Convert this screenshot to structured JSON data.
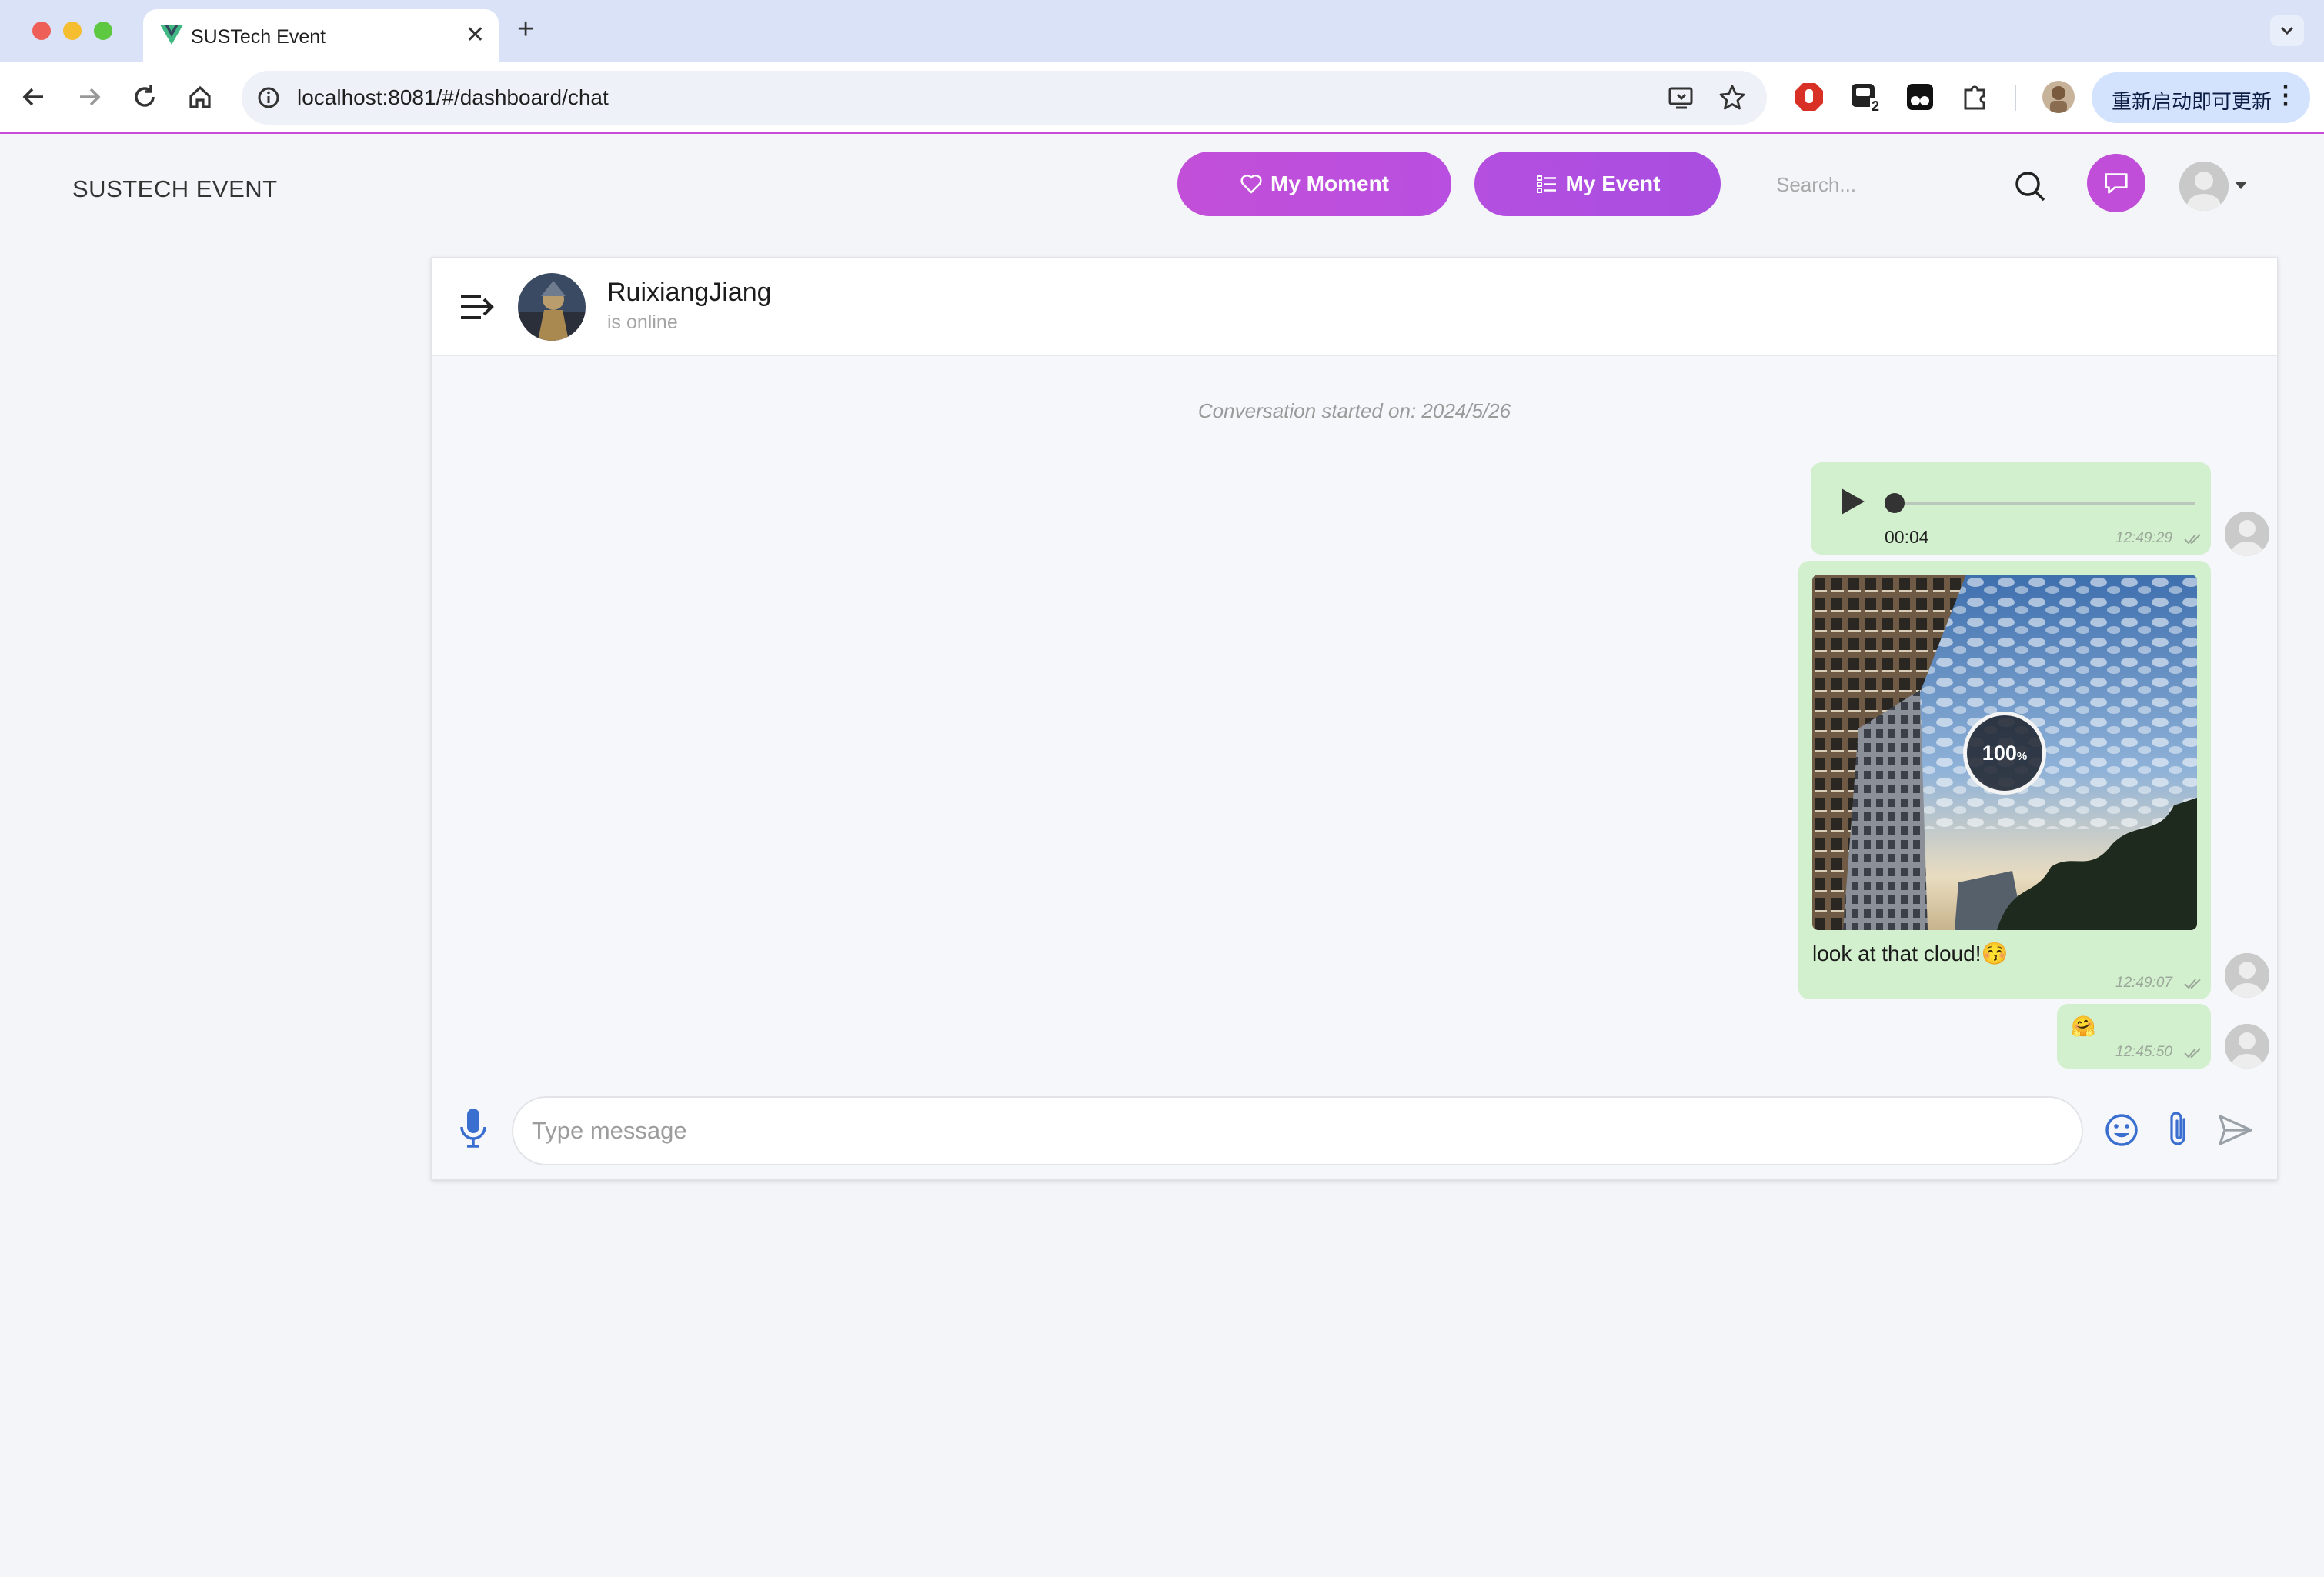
{
  "browser": {
    "tab_title": "SUSTech Event",
    "url": "localhost:8081/#/dashboard/chat",
    "update_button_label": "重新启动即可更新",
    "extension_badge": "2"
  },
  "header": {
    "brand": "SUSTECH EVENT",
    "my_moment_label": "My Moment",
    "my_event_label": "My Event",
    "search_placeholder": "Search..."
  },
  "chat": {
    "contact_name": "RuixiangJiang",
    "contact_status": "is online",
    "conversation_started": "Conversation started on: 2024/5/26",
    "messages": [
      {
        "type": "audio",
        "duration": "00:04",
        "time": "12:49:29",
        "progress": 0
      },
      {
        "type": "image",
        "upload_progress": "100",
        "upload_unit": "%",
        "caption": "look at that cloud!😚",
        "time": "12:49:07"
      },
      {
        "type": "text",
        "text": "🤗",
        "time": "12:45:50"
      }
    ],
    "composer_placeholder": "Type message"
  },
  "colors": {
    "accent": "#c04ed9",
    "bubble": "#d2f0cd",
    "page_bg": "#f4f5f8"
  }
}
